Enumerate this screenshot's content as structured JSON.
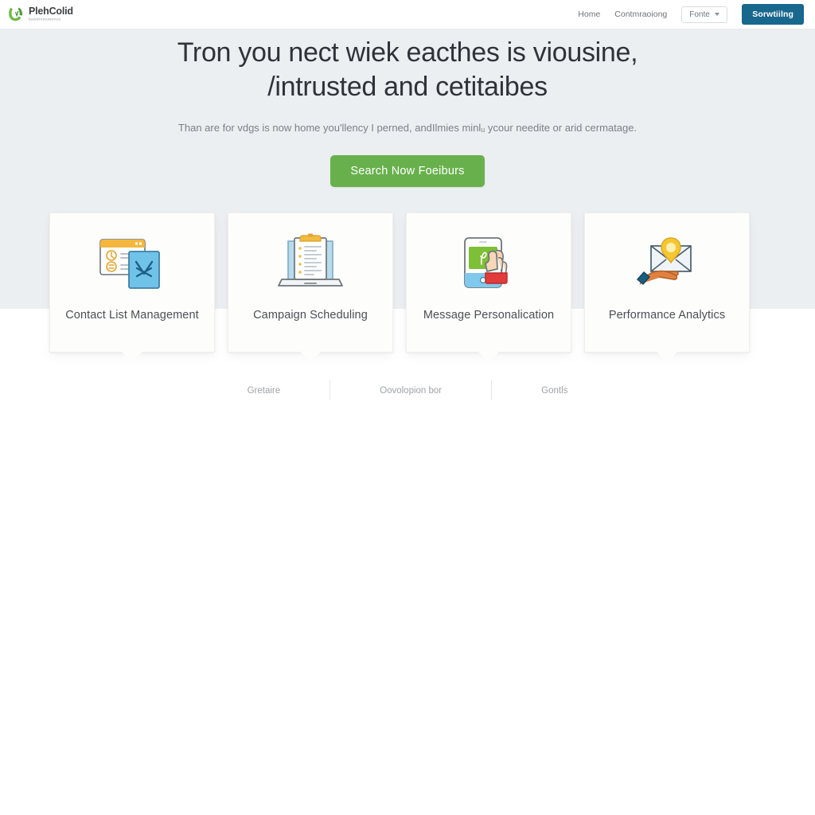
{
  "header": {
    "brand_name": "PlehColid",
    "brand_tagline": "bawdromuwunce",
    "nav_links": [
      {
        "label": "Home"
      },
      {
        "label": "Contmraoiong"
      }
    ],
    "select": {
      "value": "Fonte",
      "caret": "chevron-down-icon"
    },
    "cta_label": "Sorwtiilng"
  },
  "hero": {
    "title_line1": "Tron you nect wiek eacthes is viousine,",
    "title_line2": "/intrusted and cetitaibes",
    "subtitle": "Than are for vdgs is now home you'llency I perned, andIlmies minlᵤ ycour needite or arid cermatage.",
    "cta_label": "Search Now Foeiburs"
  },
  "cards": [
    {
      "icon": "contact-list-icon",
      "label": "Contact List Management"
    },
    {
      "icon": "campaign-schedule-icon",
      "label": "Campaign Scheduling"
    },
    {
      "icon": "message-personalization-icon",
      "label": "Message Personalication"
    },
    {
      "icon": "performance-analytics-icon",
      "label": "Performance Analytics"
    }
  ],
  "footer_links": [
    {
      "label": "Gretaire"
    },
    {
      "label": "Oovolopion bor"
    },
    {
      "label": "Gontls"
    }
  ],
  "colors": {
    "hero_band": "#eceff2",
    "page_bg": "#ffffff",
    "brand_green": "#5fa83f",
    "cta_green": "#68b04c",
    "nav_cta_blue": "#18678d",
    "card_bg": "#fdfdfc",
    "heading_text": "#2f3337",
    "muted_text": "#7b8085"
  }
}
